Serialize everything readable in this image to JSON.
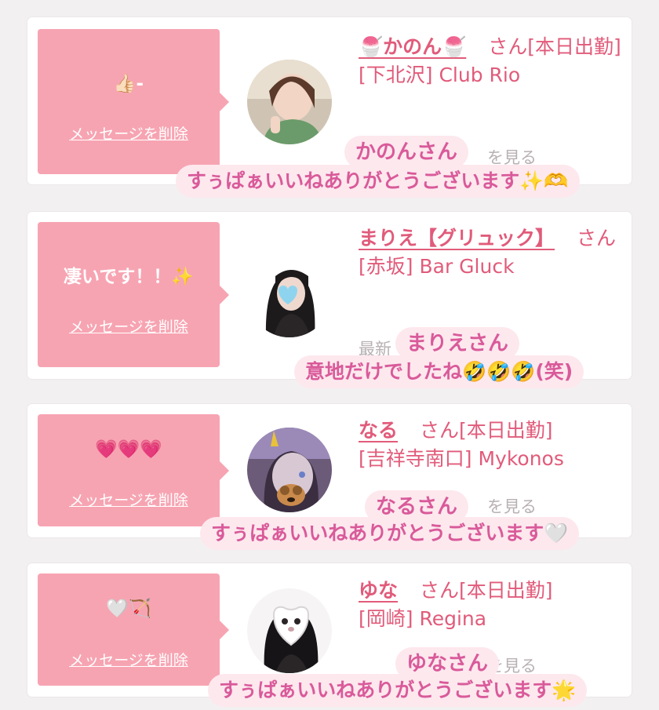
{
  "delete_label": "メッセージを削除",
  "honorific": "さん",
  "more_label": "を見る",
  "items": [
    {
      "message": "👍🏻-",
      "name": "🍧かのん🍧",
      "attendance": "[本日出勤]",
      "area": "[下北沢]",
      "store": "Club Rio",
      "overlay_name": "かのんさん",
      "overlay_message": "すぅぱぁいいねありがとうございます✨🫶"
    },
    {
      "message": "凄いです！！✨",
      "name": "まりえ【グリュック】",
      "attendance": "",
      "area": "[赤坂]",
      "store": "Bar Gluck",
      "muted_prefix": "最新",
      "overlay_name": "まりえさん",
      "overlay_message": "意地だけでしたね🤣🤣🤣(笑)"
    },
    {
      "message": "💗💗💗",
      "name": "なる",
      "attendance": "[本日出勤]",
      "area": "[吉祥寺南口]",
      "store": "Mykonos",
      "overlay_name": "なるさん",
      "overlay_message": "すぅぱぁいいねありがとうございます🤍"
    },
    {
      "message": "🤍🏹",
      "name": "ゆな",
      "attendance": "[本日出勤]",
      "area": "[岡崎]",
      "store": "Regina",
      "overlay_name": "ゆなさん",
      "overlay_message": "すぅぱぁいいねありがとうございます🌟"
    }
  ],
  "colors": {
    "accent": "#e15b7a",
    "message_box": "#f7a4b2",
    "overlay_bg": "#fde8ee",
    "overlay_text": "#d95a9a"
  }
}
